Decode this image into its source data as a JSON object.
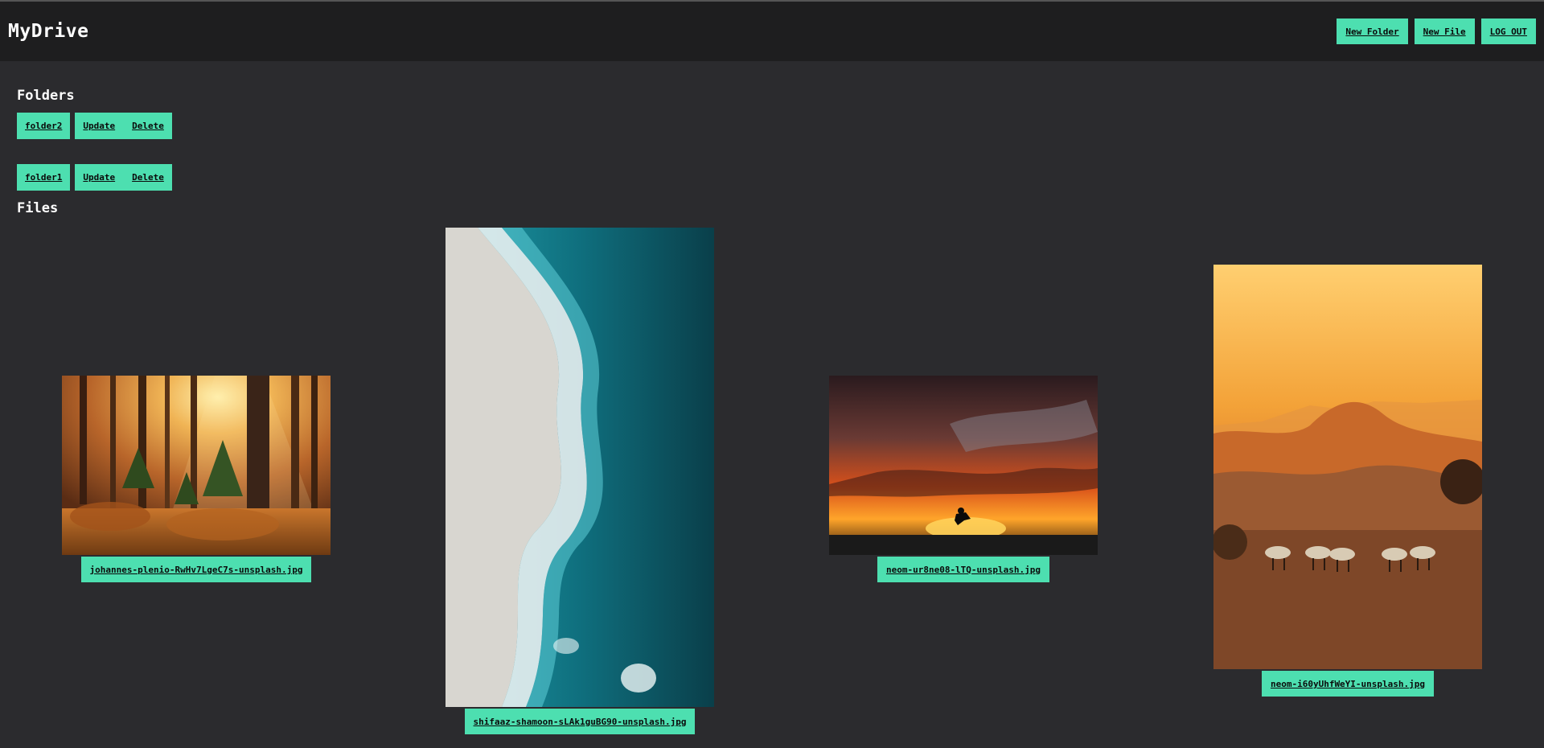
{
  "app": {
    "title": "MyDrive"
  },
  "nav": {
    "new_folder": "New Folder",
    "new_file": "New File",
    "logout": "LOG OUT"
  },
  "folders": {
    "heading": "Folders",
    "items": [
      {
        "name": "folder2",
        "update": "Update",
        "delete": "Delete"
      },
      {
        "name": "folder1",
        "update": "Update",
        "delete": "Delete"
      }
    ]
  },
  "files": {
    "heading": "Files",
    "items": [
      {
        "name": "johannes-plenio-RwHv7LgeC7s-unsplash.jpg"
      },
      {
        "name": "shifaaz-shamoon-sLAk1guBG90-unsplash.jpg"
      },
      {
        "name": "neom-ur8ne08-lTQ-unsplash.jpg"
      },
      {
        "name": "neom-i60yUhfWeYI-unsplash.jpg"
      }
    ]
  },
  "colors": {
    "accent": "#4ddfb0",
    "background": "#2b2b2e",
    "header": "#1e1e1f"
  }
}
